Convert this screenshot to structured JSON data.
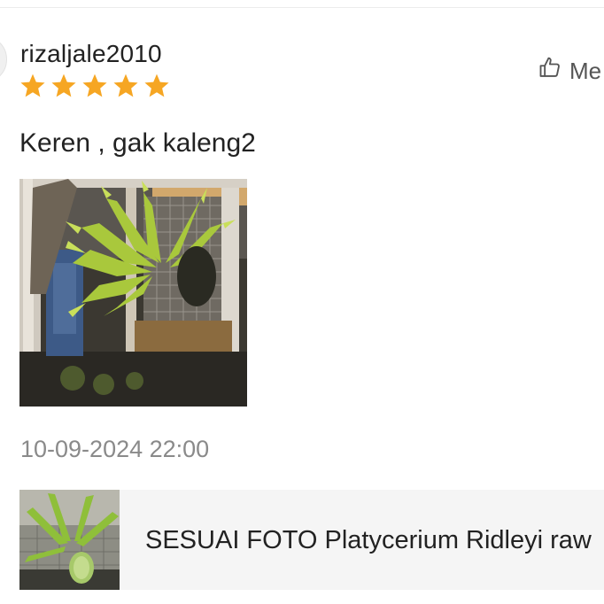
{
  "review": {
    "username": "rizaljale2010",
    "rating": 5,
    "rating_max": 5,
    "star_color": "#F6A623",
    "helpful_label": "Me",
    "comment": "Keren , gak kaleng2",
    "timestamp": "10-09-2024 22:00",
    "photo_icon": "staghorn-fern-photo"
  },
  "product": {
    "name": "SESUAI FOTO Platycerium Ridleyi raw",
    "thumb_icon": "staghorn-fern-thumbnail"
  }
}
